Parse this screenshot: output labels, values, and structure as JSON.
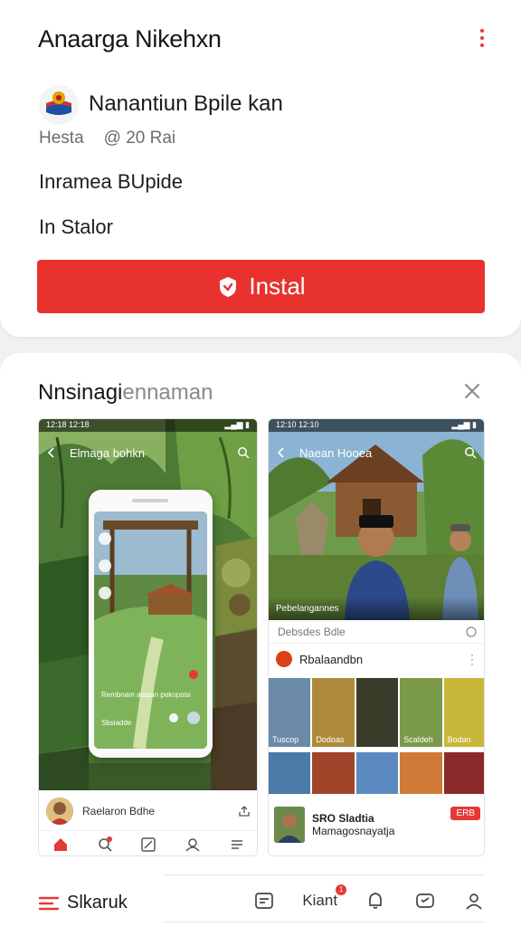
{
  "app": {
    "title": "Anaarga Nikehxn",
    "developer": "Nanantiun Bpile kan",
    "meta_left": "Hesta",
    "meta_right": "@ 20 Rai",
    "line_a": "Inramea BUpide",
    "line_b": "In Stalor",
    "install_label": "Instal"
  },
  "gallery": {
    "title_main": "Nnsinagi",
    "title_muted": "ennaman"
  },
  "shot_left": {
    "status_time": "12:18 12:18",
    "header": "Elmaga bohkn",
    "overlay_text": "Rembnam atasan pekopsisi",
    "overlay_bottom": "Sbsiadde",
    "footer_name": "Raelaron Bdhe"
  },
  "shot_right": {
    "status_time": "12:10 12:10",
    "header": "Naean Hooea",
    "caption": "Pebelangannes",
    "info": "Debsdes Bdle",
    "section": "Rbalaandbn",
    "thumbs_row1": [
      "Tuscop",
      "Dodoas",
      "",
      "Scaldeh",
      "Bodan"
    ],
    "card_title": "SRO Sladtia",
    "card_sub": "Mamagosnayatja",
    "badge": "ERB"
  },
  "bottom_nav": {
    "left_label": "Slkaruk",
    "mid_label": "Kiant",
    "notif_count": "1"
  },
  "colors": {
    "accent": "#e8322e",
    "title_text": "#161616",
    "muted_text": "#8a8a8a"
  }
}
